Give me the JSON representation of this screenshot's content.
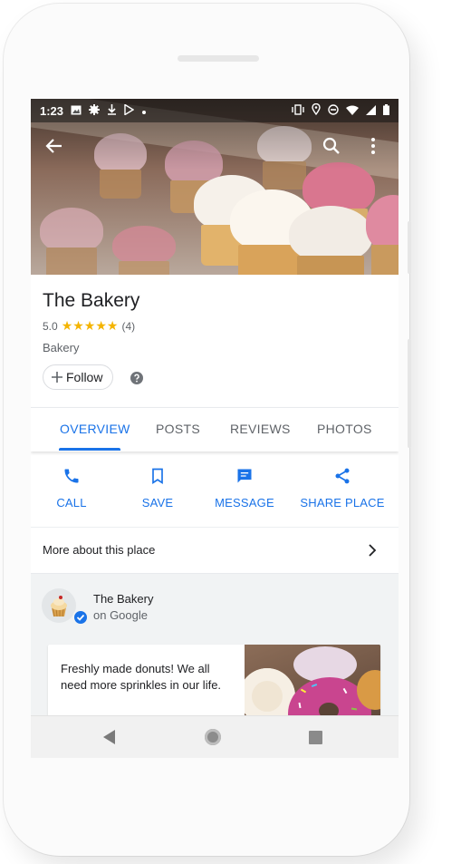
{
  "status_bar": {
    "time": "1:23"
  },
  "place": {
    "name": "The Bakery",
    "rating": "5.0",
    "stars": "★★★★★",
    "review_count": "(4)",
    "category": "Bakery",
    "follow_label": "Follow"
  },
  "tabs": [
    {
      "label": "OVERVIEW",
      "active": true
    },
    {
      "label": "POSTS",
      "active": false
    },
    {
      "label": "REVIEWS",
      "active": false
    },
    {
      "label": "PHOTOS",
      "active": false
    }
  ],
  "actions": [
    {
      "label": "CALL",
      "icon": "phone-icon"
    },
    {
      "label": "SAVE",
      "icon": "bookmark-icon"
    },
    {
      "label": "MESSAGE",
      "icon": "message-icon"
    },
    {
      "label": "SHARE PLACE",
      "icon": "share-icon"
    }
  ],
  "more_about": {
    "label": "More about this place"
  },
  "owner": {
    "name": "The Bakery",
    "subtitle": "on Google"
  },
  "post": {
    "text": "Freshly made donuts! We all need more sprinkles in our life."
  },
  "colors": {
    "accent": "#1a73e8",
    "star": "#f4b400",
    "text_primary": "#202124",
    "text_secondary": "#5f6368"
  }
}
